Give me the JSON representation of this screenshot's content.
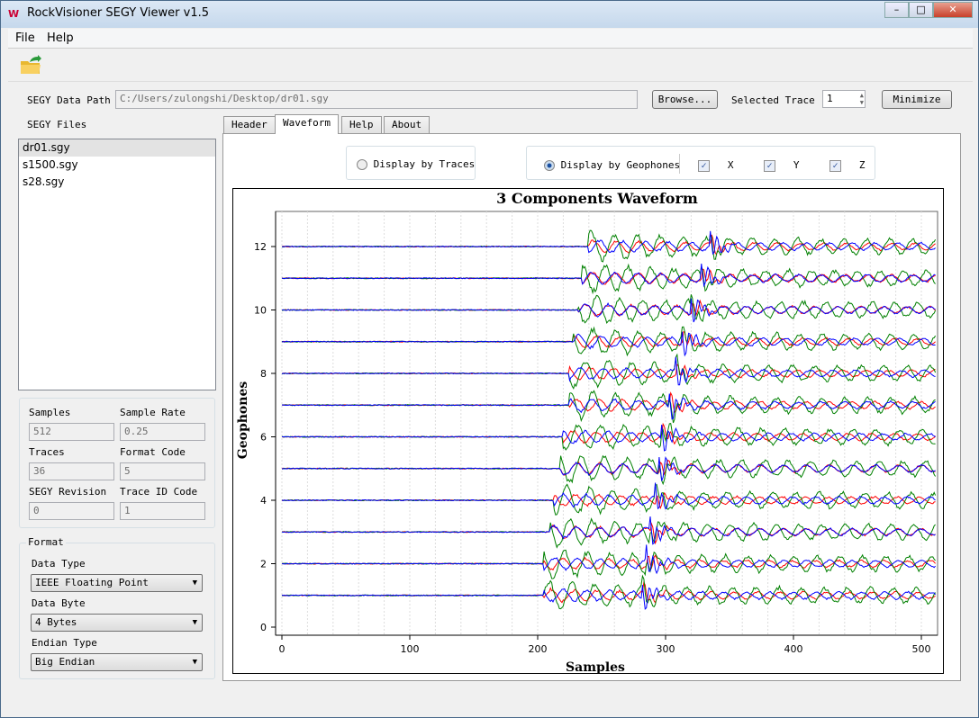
{
  "window": {
    "title": "RockVisioner SEGY Viewer v1.5",
    "logo": "W"
  },
  "menu": [
    "File",
    "Help"
  ],
  "toolbar": {
    "open_icon": "open-folder-icon"
  },
  "path": {
    "label": "SEGY Data Path",
    "value": "C:/Users/zulongshi/Desktop/dr01.sgy",
    "browse": "Browse...",
    "selected_trace_label": "Selected Trace",
    "selected_trace": "1",
    "minimize": "Minimize"
  },
  "files": {
    "label": "SEGY Files",
    "items": [
      "dr01.sgy",
      "s1500.sgy",
      "s28.sgy"
    ],
    "selected": 0
  },
  "info": {
    "samples_label": "Samples",
    "samples": "512",
    "rate_label": "Sample Rate",
    "rate": "0.25",
    "traces_label": "Traces",
    "traces": "36",
    "format_code_label": "Format Code",
    "format_code": "5",
    "revision_label": "SEGY Revision",
    "revision": "0",
    "trace_id_label": "Trace ID Code",
    "trace_id": "1"
  },
  "format": {
    "title": "Format",
    "data_type_label": "Data Type",
    "data_type": "IEEE Floating Point",
    "data_byte_label": "Data Byte",
    "data_byte": "4 Bytes",
    "endian_label": "Endian Type",
    "endian": "Big Endian"
  },
  "tabs": [
    "Header",
    "Waveform",
    "Help",
    "About"
  ],
  "active_tab": 1,
  "options": {
    "by_traces": "Display by Traces",
    "by_geophones": "Display by Geophones",
    "mode": "geophones",
    "x": "X",
    "y": "Y",
    "z": "Z",
    "x_checked": true,
    "y_checked": true,
    "z_checked": true
  },
  "chart_data": {
    "type": "line",
    "title": "3 Components Waveform",
    "xlabel": "Samples",
    "ylabel": "Geophones",
    "xlim": [
      0,
      512
    ],
    "ylim": [
      0,
      13
    ],
    "xticks": [
      0,
      100,
      200,
      300,
      400,
      500
    ],
    "yticks": [
      0,
      2,
      4,
      6,
      8,
      10,
      12
    ],
    "grid": true,
    "series": [
      {
        "name": "X",
        "color": "#ff0000"
      },
      {
        "name": "Y",
        "color": "#008000"
      },
      {
        "name": "Z",
        "color": "#0000ff"
      }
    ],
    "geophones": [
      1,
      2,
      3,
      4,
      5,
      6,
      7,
      8,
      9,
      10,
      11,
      12
    ],
    "p_onset_samples": [
      205,
      205,
      210,
      213,
      218,
      220,
      225,
      225,
      228,
      232,
      235,
      240
    ],
    "s_onset_samples": [
      282,
      285,
      288,
      292,
      295,
      297,
      303,
      308,
      313,
      320,
      328,
      335
    ]
  }
}
